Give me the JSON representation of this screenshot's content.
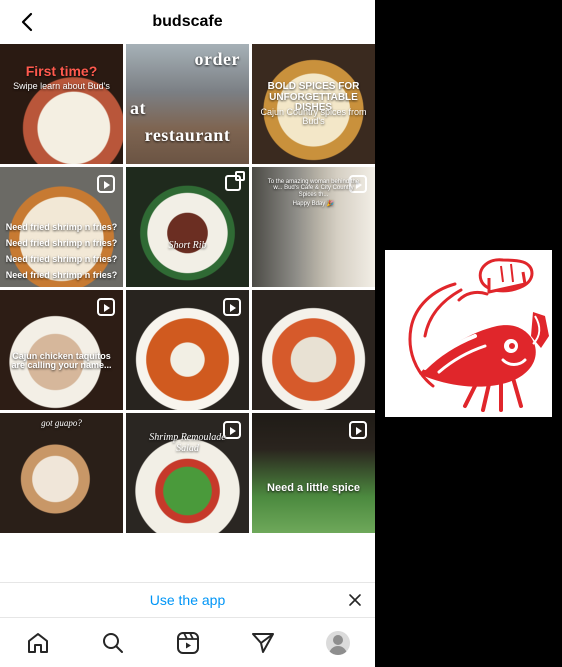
{
  "header": {
    "title": "budscafe"
  },
  "tiles": [
    {
      "caption1": "First time?",
      "caption2": "Swipe learn about Bud's"
    },
    {
      "caption1": "order",
      "caption2": "at",
      "caption3": "restaurant"
    },
    {
      "caption1": "BOLD SPICES FOR UNFORGETTABLE DISHES",
      "caption2": "Cajun Country spices from Bud's"
    },
    {
      "caption1": "Need fried shrimp n fries?",
      "caption2": "Need fried shrimp n fries?",
      "caption3": "Need fried shrimp n fries?",
      "caption4": "Need fried shrimp n fries?"
    },
    {
      "caption1": "Short Rib"
    },
    {
      "caption1": "To the amazing woman behind the w... Bud's Cafe & City Country Spices th...",
      "caption2": "Happy Bday 🎉"
    },
    {
      "caption1": "Cajun chicken taquitos are calling your name..."
    },
    {},
    {},
    {
      "caption1": "got guapo?"
    },
    {
      "caption1": "Shrimp Remoulade Salad"
    },
    {
      "caption1": "Need a little spice"
    }
  ],
  "use_app": {
    "label": "Use the app"
  },
  "nav_icons": [
    "home-icon",
    "search-icon",
    "reels-icon",
    "send-icon",
    "profile-icon"
  ],
  "colors": {
    "accent": "#0095f6",
    "logo_red": "#e0262b"
  }
}
